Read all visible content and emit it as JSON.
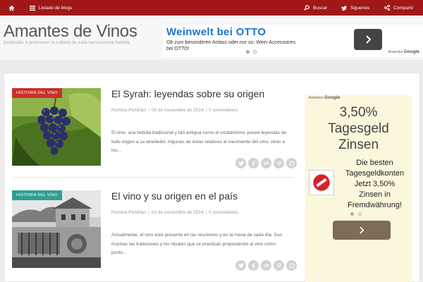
{
  "topbar": {
    "home_icon": "home-icon",
    "listado_label": "Listado de blogs",
    "buscar_label": "Buscar",
    "siguenos_label": "Siguenos",
    "compartir_label": "Compartir",
    "colors": {
      "bar": "#a01818"
    }
  },
  "header": {
    "title": "Amantes de Vinos",
    "description": "Dedicado a promover la cultura de esta sensacional bebida"
  },
  "ad_top": {
    "headline": "Weinwelt bei OTTO",
    "text": "Ob zum besonderen Anlass oder nur so: Wein-Accessoires bei OTTO!",
    "label_small": "Anuncios",
    "label_brand": "Google"
  },
  "posts": [
    {
      "category": "Historia del vino",
      "title": "El Syrah: leyendas sobre su origen",
      "author": "Romina Pichiñan",
      "date": "05 de noviembre de 2014",
      "comments": "0 comentarios",
      "excerpt": "El vino, una bebida tradicional y tan antigua como el cristianismo, posee leyendas de todo origen a su alrededor. Algunas de éstas relativas al nacimiento del vino, otras a los…"
    },
    {
      "category": "Historia del vino",
      "title": "El vino y su origen en el país",
      "author": "Romina Pichiñan",
      "date": "03 de noviembre de 2014",
      "comments": "0 comentarios",
      "excerpt": "Actualmente, el vino está presente en las reuniones y en la mesa de cada día. Son muchas las tradiciones y los rituales que se practican proponiendo al vino como punto…"
    }
  ],
  "share_icons": [
    "twitter-icon",
    "facebook-icon",
    "google-plus-icon",
    "pinterest-icon",
    "whatsapp-icon"
  ],
  "side_ad": {
    "label_small": "Anuncios",
    "label_brand": "Google",
    "big_line1": "3,50%",
    "big_line2": "Tagesgeld",
    "big_line3": "Zinsen",
    "text_line1": "Die besten",
    "text_line2": "Tagesgeldkonten",
    "text_line3": "Jetzt 3,50%",
    "text_line4": "Zinsen in",
    "text_line5": "Fremdwährung!"
  }
}
